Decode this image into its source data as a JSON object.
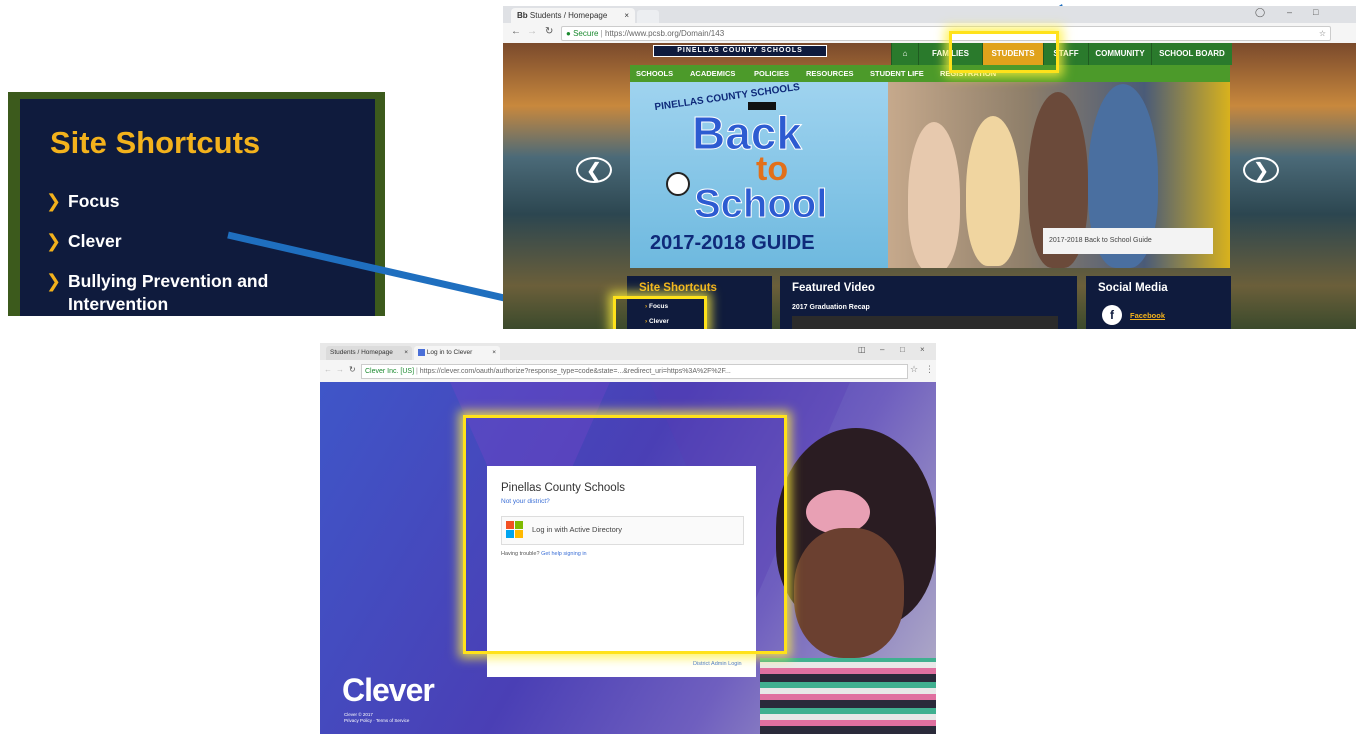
{
  "zoom_panel": {
    "title": "Site Shortcuts",
    "items": [
      "Focus",
      "Clever",
      "Bullying Prevention and",
      "Intervention"
    ]
  },
  "top_browser": {
    "tab_label": "Students / Homepage",
    "tab_icon": "Bb",
    "secure_label": "Secure",
    "url": "https://www.pcsb.org/Domain/143",
    "site": {
      "logo": "PINELLAS COUNTY SCHOOLS",
      "main_nav": [
        "FAMILIES",
        "STUDENTS",
        "STAFF",
        "COMMUNITY",
        "SCHOOL BOARD"
      ],
      "sub_nav": [
        "SCHOOLS",
        "ACADEMICS",
        "POLICIES",
        "RESOURCES",
        "STUDENT LIFE",
        "REGISTRATION"
      ],
      "hero": {
        "district": "PINELLAS COUNTY SCHOOLS",
        "back": "Back",
        "to": "to",
        "school": "School",
        "guide": "2017-2018 GUIDE",
        "caption": "2017-2018 Back to School Guide"
      },
      "shortcuts_title": "Site Shortcuts",
      "shortcuts_items": [
        "Focus",
        "Clever"
      ],
      "featured_title": "Featured Video",
      "featured_item": "2017 Graduation Recap",
      "social_title": "Social Media",
      "social_item": "Facebook"
    }
  },
  "bottom_browser": {
    "tab1_label": "Students / Homepage",
    "tab2_label": "Log in to Clever",
    "cert_label": "Clever Inc. [US]",
    "url": "https://clever.com/oauth/authorize?response_type=code&state=...&redirect_uri=https%3A%2F%2F...",
    "login": {
      "district": "Pinellas County Schools",
      "not_district": "Not your district?",
      "ad_button": "Log in with Active Directory",
      "trouble": "Having trouble?",
      "help_link": "Get help signing in",
      "admin_link": "District Admin Login"
    },
    "brand": "Clever",
    "footer1": "Clever © 2017",
    "footer2": "Privacy Policy · Terms of Service"
  }
}
